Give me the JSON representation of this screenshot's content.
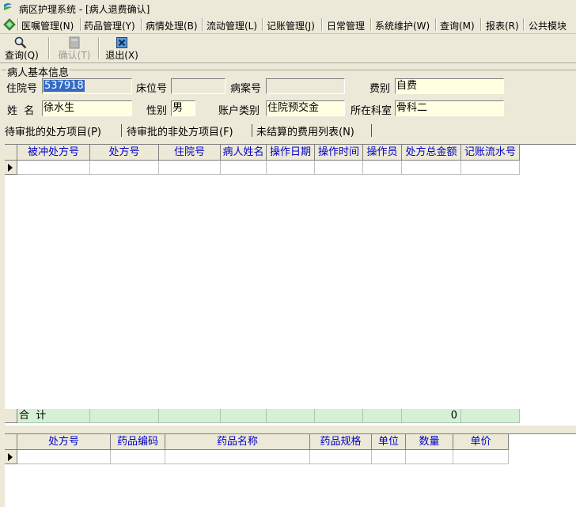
{
  "window": {
    "title": "病区护理系统 - [病人退费确认]"
  },
  "menu": [
    {
      "label": "医嘱管理(N)"
    },
    {
      "label": "药品管理(Y)"
    },
    {
      "label": "病情处理(B)"
    },
    {
      "label": "流动管理(L)"
    },
    {
      "label": "记账管理(J)"
    },
    {
      "label": "日常管理"
    },
    {
      "label": "系统维护(W)"
    },
    {
      "label": "查询(M)"
    },
    {
      "label": "报表(R)"
    },
    {
      "label": "公共模块"
    }
  ],
  "toolbar": {
    "query_label": "查询(Q)",
    "confirm_label": "确认(T)",
    "exit_label": "退出(X)"
  },
  "patient": {
    "group_title": "病人基本信息",
    "admission_no_label": "住院号",
    "admission_no": "537918",
    "bed_no_label": "床位号",
    "bed_no": "",
    "record_no_label": "病案号",
    "record_no": "",
    "fee_type_label": "费别",
    "fee_type": "自费",
    "name_label": "姓  名",
    "name": "徐水生",
    "gender_label": "性别",
    "gender": "男",
    "account_type_label": "账户类别",
    "account_type": "住院预交金",
    "department_label": "所在科室",
    "department": "骨科二"
  },
  "tabs": [
    {
      "label": "待审批的处方项目(P)",
      "active": true
    },
    {
      "label": "待审批的非处方项目(F)",
      "active": false
    },
    {
      "label": "未结算的费用列表(N)",
      "active": false
    }
  ],
  "main_grid": {
    "columns": [
      "被冲处方号",
      "处方号",
      "住院号",
      "病人姓名",
      "操作日期",
      "操作时间",
      "操作员",
      "处方总金额",
      "记账流水号"
    ],
    "total_label": "合  计",
    "total_amount": "0"
  },
  "detail_grid": {
    "columns": [
      "处方号",
      "药品编码",
      "药品名称",
      "药品规格",
      "单位",
      "数量",
      "单价"
    ]
  },
  "colors": {
    "window_bg": "#ece9d8",
    "header_text": "#0000c8",
    "total_row": "#d5f0d5",
    "input_yellow": "#ffffe1",
    "selection": "#316ac5"
  }
}
